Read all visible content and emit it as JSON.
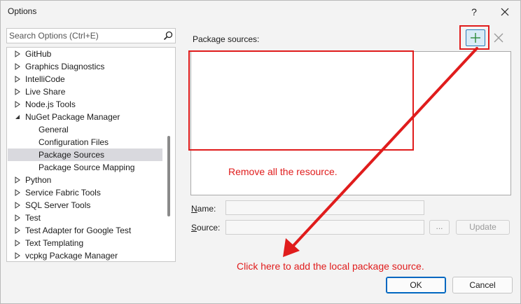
{
  "window": {
    "title": "Options",
    "help_label": "?"
  },
  "search": {
    "placeholder": "Search Options (Ctrl+E)",
    "value": ""
  },
  "tree": {
    "items": [
      {
        "label": "GitHub",
        "expandable": true,
        "expanded": false,
        "selected": false
      },
      {
        "label": "Graphics Diagnostics",
        "expandable": true,
        "expanded": false,
        "selected": false
      },
      {
        "label": "IntelliCode",
        "expandable": true,
        "expanded": false,
        "selected": false
      },
      {
        "label": "Live Share",
        "expandable": true,
        "expanded": false,
        "selected": false
      },
      {
        "label": "Node.js Tools",
        "expandable": true,
        "expanded": false,
        "selected": false
      },
      {
        "label": "NuGet Package Manager",
        "expandable": true,
        "expanded": true,
        "selected": false
      },
      {
        "label": "General",
        "expandable": false,
        "expanded": false,
        "selected": false,
        "child": true
      },
      {
        "label": "Configuration Files",
        "expandable": false,
        "expanded": false,
        "selected": false,
        "child": true
      },
      {
        "label": "Package Sources",
        "expandable": false,
        "expanded": false,
        "selected": true,
        "child": true
      },
      {
        "label": "Package Source Mapping",
        "expandable": false,
        "expanded": false,
        "selected": false,
        "child": true
      },
      {
        "label": "Python",
        "expandable": true,
        "expanded": false,
        "selected": false
      },
      {
        "label": "Service Fabric Tools",
        "expandable": true,
        "expanded": false,
        "selected": false
      },
      {
        "label": "SQL Server Tools",
        "expandable": true,
        "expanded": false,
        "selected": false
      },
      {
        "label": "Test",
        "expandable": true,
        "expanded": false,
        "selected": false
      },
      {
        "label": "Test Adapter for Google Test",
        "expandable": true,
        "expanded": false,
        "selected": false
      },
      {
        "label": "Text Templating",
        "expandable": true,
        "expanded": false,
        "selected": false
      },
      {
        "label": "vcpkg Package Manager",
        "expandable": true,
        "expanded": false,
        "selected": false
      }
    ]
  },
  "package_sources": {
    "label": "Package sources:",
    "items": [],
    "add_icon": "plus-icon",
    "remove_icon": "x-icon"
  },
  "form": {
    "name_label_accel": "N",
    "name_label_rest": "ame:",
    "name_value": "",
    "source_label_accel": "S",
    "source_label_rest": "ource:",
    "source_value": "",
    "browse_label": "...",
    "update_label": "Update"
  },
  "annotations": {
    "remove_note": "Remove all the resource.",
    "click_note": "Click here to add the local package source.",
    "color": "#e01c1c"
  },
  "footer": {
    "ok_label": "OK",
    "cancel_label": "Cancel"
  },
  "colors": {
    "accent": "#0067c0",
    "selection": "#d9d9de",
    "annotation_red": "#e01c1c",
    "add_green": "#2e8b3a"
  }
}
